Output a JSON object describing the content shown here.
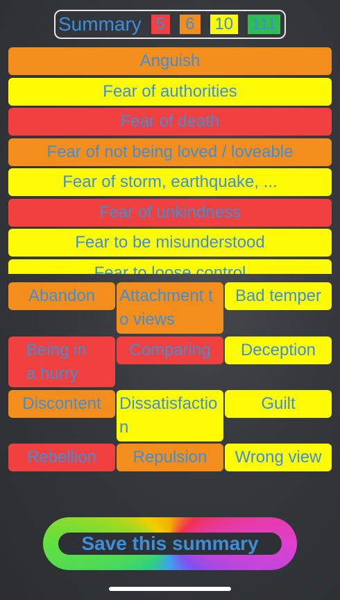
{
  "header": {
    "title": "Summary",
    "counts": {
      "red": "5",
      "orange": "6",
      "yellow": "10",
      "green": "111"
    }
  },
  "list": [
    {
      "label": "Anguish",
      "color": "#f38e1c"
    },
    {
      "label": "Fear of authorities",
      "color": "#fffb06"
    },
    {
      "label": "Fear of death",
      "color": "#f04040"
    },
    {
      "label": "Fear of not being loved / loveable",
      "color": "#f38e1c"
    },
    {
      "label": "Fear of storm, earthquake, ...",
      "color": "#fffb06"
    },
    {
      "label": "Fear of unkindness",
      "color": "#f04040"
    },
    {
      "label": "Fear to be misunderstood",
      "color": "#fffb06"
    },
    {
      "label": "Fear to loose control",
      "color": "#fffb06"
    }
  ],
  "grid": [
    {
      "label": "Abandon",
      "color": "#f38e1c"
    },
    {
      "label": "Attachment to views",
      "color": "#f38e1c"
    },
    {
      "label": "Bad temper",
      "color": "#fffb06"
    },
    {
      "label": "Being in a hurry",
      "color": "#f04040"
    },
    {
      "label": "Comparing",
      "color": "#f04040"
    },
    {
      "label": "Deception",
      "color": "#fffb06"
    },
    {
      "label": "Discontent",
      "color": "#f38e1c"
    },
    {
      "label": "Dissatisfaction",
      "color": "#fffb06"
    },
    {
      "label": "Guilt",
      "color": "#fffb06"
    },
    {
      "label": "Rebellion",
      "color": "#f04040"
    },
    {
      "label": "Repulsion",
      "color": "#f38e1c"
    },
    {
      "label": "Wrong view",
      "color": "#fffb06"
    }
  ],
  "save_button": {
    "label": "Save this summary"
  },
  "colors": {
    "text": "#3f8fd8",
    "red": "#f04040",
    "orange": "#f38e1c",
    "yellow": "#fffb06",
    "green": "#2fbf4f"
  }
}
